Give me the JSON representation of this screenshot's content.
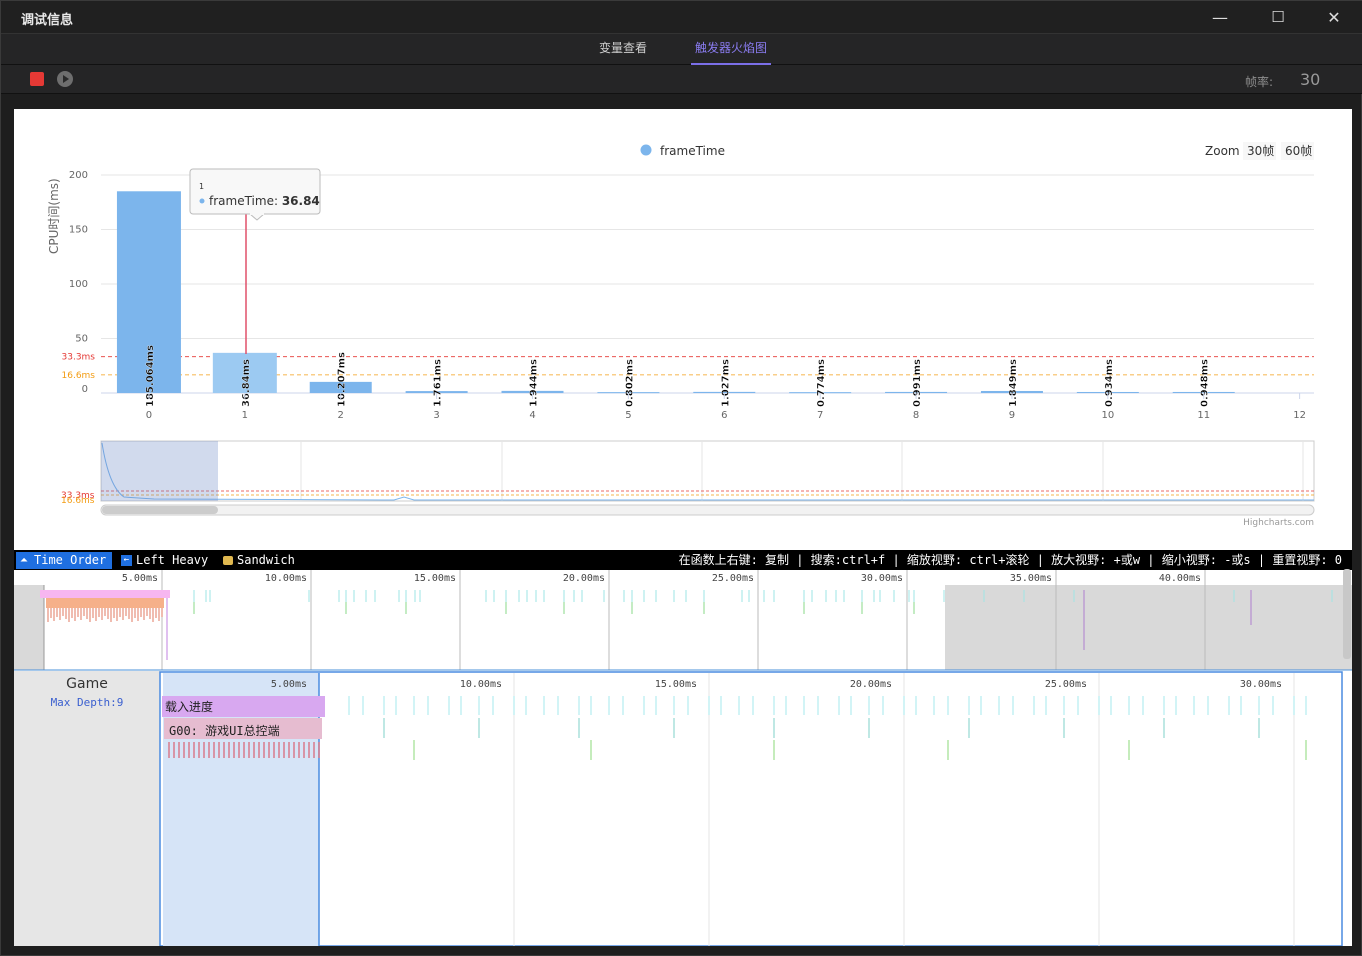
{
  "window": {
    "title": "调试信息",
    "min": "—",
    "max": "☐",
    "close": "✕"
  },
  "tabs": [
    {
      "label": "变量查看"
    },
    {
      "label": "触发器火焰图"
    }
  ],
  "toolbar": {
    "fps_label": "帧率:",
    "fps_value": "30"
  },
  "chart_data": {
    "type": "bar",
    "legend": "frameTime",
    "ylabel": "CPU时间(ms)",
    "ylim": [
      0,
      200
    ],
    "yticks": [
      "0",
      "50",
      "100",
      "150",
      "200"
    ],
    "categories": [
      "0",
      "1",
      "2",
      "3",
      "4",
      "5",
      "6",
      "7",
      "8",
      "9",
      "10",
      "11",
      "12"
    ],
    "values": [
      185.064,
      36.84,
      10.207,
      1.761,
      1.944,
      0.802,
      1.027,
      0.774,
      0.991,
      1.849,
      0.934,
      0.948,
      null
    ],
    "data_labels": [
      "185.064ms",
      "36.84ms",
      "10.207ms",
      "1.761ms",
      "1.944ms",
      "0.802ms",
      "1.027ms",
      "0.774ms",
      "0.991ms",
      "1.849ms",
      "0.934ms",
      "0.948ms"
    ],
    "plot_lines": [
      {
        "label": "33.3ms",
        "value": 33.3,
        "color": "#e53935"
      },
      {
        "label": "16.6ms",
        "value": 16.6,
        "color": "#f39c12"
      }
    ],
    "navigator_lines": [
      "33.3ms",
      "16.6ms"
    ],
    "series_color": "#7cb5ec",
    "tooltip": {
      "header": "1",
      "series": "frameTime",
      "value": "36.84"
    },
    "zoom": {
      "label": "Zoom",
      "options": [
        "30帧",
        "60帧"
      ]
    },
    "credits": "Highcharts.com"
  },
  "flame": {
    "tabs": [
      {
        "label": "Time Order",
        "icon": "sort-icon"
      },
      {
        "label": "Left Heavy",
        "icon": "arrow-left-icon"
      },
      {
        "label": "Sandwich",
        "icon": "sandwich-icon"
      }
    ],
    "help": "在函数上右键: 复制 | 搜索:ctrl+f | 缩放视野: ctrl+滚轮 | 放大视野: +或w | 缩小视野: -或s | 重置视野: 0",
    "overview_ticks": [
      "5.00ms",
      "10.00ms",
      "15.00ms",
      "20.00ms",
      "25.00ms",
      "30.00ms",
      "35.00ms",
      "40.00ms"
    ],
    "detail_ticks": [
      "5.00ms",
      "10.00ms",
      "15.00ms",
      "20.00ms",
      "25.00ms",
      "30.00ms"
    ],
    "thread": {
      "name": "Game",
      "depth": "Max Depth:9"
    },
    "frames": [
      {
        "label": "载入进度"
      },
      {
        "label": "G00: 游戏UI总控端"
      }
    ]
  }
}
